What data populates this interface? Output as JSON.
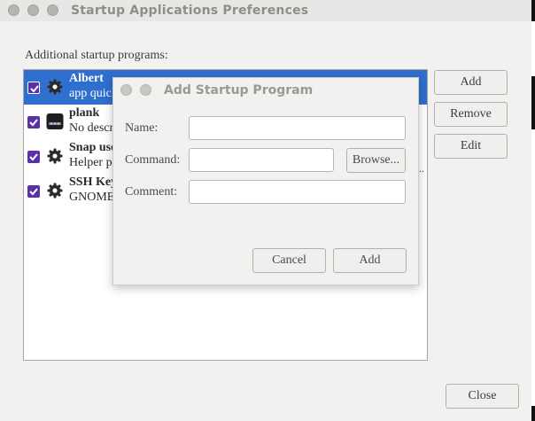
{
  "window": {
    "title": "Startup Applications Preferences"
  },
  "section_label": "Additional startup programs:",
  "programs": [
    {
      "name": "Albert",
      "description": "app quick",
      "checked": true,
      "selected": true,
      "icon": "gear-icon"
    },
    {
      "name": "plank",
      "description": "No descr",
      "checked": true,
      "selected": false,
      "icon": "plank-dock-icon"
    },
    {
      "name": "Snap use",
      "description": "Helper pr",
      "checked": true,
      "selected": false,
      "icon": "gear-icon"
    },
    {
      "name": "SSH Key",
      "description": "GNOME I",
      "checked": true,
      "selected": false,
      "icon": "gear-icon"
    }
  ],
  "buttons": {
    "add": "Add",
    "remove": "Remove",
    "edit": "Edit",
    "close": "Close"
  },
  "stray_text": "...",
  "dialog": {
    "title": "Add Startup Program",
    "name_label": "Name:",
    "command_label": "Command:",
    "comment_label": "Comment:",
    "name_value": "",
    "command_value": "",
    "comment_value": "",
    "browse_label": "Browse...",
    "cancel_label": "Cancel",
    "add_label": "Add"
  },
  "colors": {
    "selection": "#2f6fd0",
    "checkbox": "#5b2fa5",
    "background": "#f2f1f0"
  }
}
